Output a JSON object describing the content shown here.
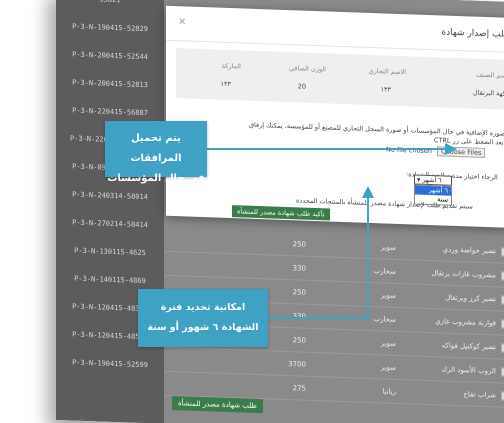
{
  "codes": [
    "53821",
    "P-3-N-190415-52829",
    "P-3-N-200415-52544",
    "P-3-N-200415-52813",
    "P-3-N-220415-56887",
    "P-3-N-220415-116340",
    "P-3-N-090214-30365",
    "P-3-N-240314-58014",
    "P-3-N-270214-58414",
    "P-3-N-130115-4625",
    "P-3-N-140115-4869",
    "P-3-N-120415-48350",
    "P-3-N-120415-48562",
    "P-3-N-190415-52599"
  ],
  "bg_rows": [
    {
      "name": "تضير حواضة وردي",
      "brand": "سوبر",
      "qty": "250"
    },
    {
      "name": "مشروب غازات برتقال",
      "brand": "سحارب",
      "qty": "330"
    },
    {
      "name": "تضير كرز وبرتقال",
      "brand": "سوبر",
      "qty": "250"
    },
    {
      "name": "قوارنة مشروب غازي",
      "brand": "سحارب",
      "qty": "330"
    },
    {
      "name": "تضير كوكتيل فواكه",
      "brand": "سوبر",
      "qty": "250"
    },
    {
      "name": "الزوب الأسود الرك",
      "brand": "سوبر",
      "qty": "3700"
    },
    {
      "name": "شراب تفاح",
      "brand": "ريانيا",
      "qty": "275"
    }
  ],
  "bottom_button": "طلب شهادة مصدر للمنشأة",
  "modal": {
    "title": "طلب إصدار شهادة",
    "close": "×",
    "headers": [
      "اسم الصنف",
      "الاسم التجاري",
      "الوزن الصافي",
      "الماركة"
    ],
    "row": [
      "نكهة البرتقال",
      "١٣٣",
      "20",
      "١٣٣"
    ],
    "note": "يمكنك إرفاق صورة الإضافية في حال المؤسسات أو صورة السجل التجاري للمصنع أو للمؤسسة، يمكنك إرفاق أكثر من ملف بعد الضغط على زر CTRL",
    "file_status": "No file chosen",
    "file_button": "Choose Files",
    "validity_label": "الرجاء اختيار مدة صلاحية الشهادة:",
    "select_value": "٦ أشهر",
    "options": [
      "٦ أشهر",
      "سنة"
    ],
    "disclaimer": "سيتم تقديم طلب لإصدار شهادة مصدر للمنشأة بالمنتجات المحددة",
    "confirm": "تأكيد طلب شهادة مصدر للمنشأة"
  },
  "callouts": {
    "c1_line1": "يتم تحميل المرافقات",
    "c1_line2": "في حال المؤسسات",
    "c2_line1": "امكانية تحديد فترة",
    "c2_line2": "الشهادة ٦ شهور أو سنة"
  },
  "colors": {
    "callout": "#3fa2c4",
    "button": "#3a7d4a",
    "select_highlight": "#2b6fd6"
  }
}
